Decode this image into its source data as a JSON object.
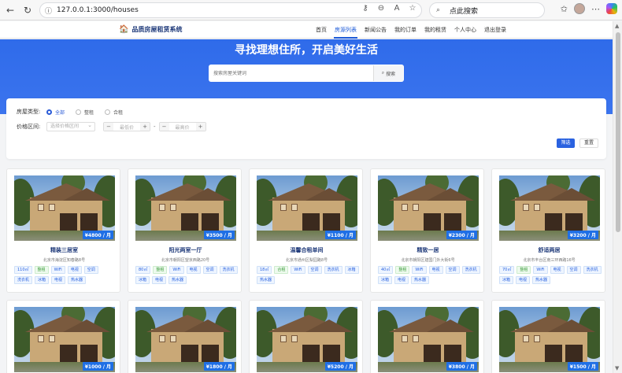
{
  "browser": {
    "url": "127.0.0.1:3000/houses",
    "search_placeholder": "点此搜索"
  },
  "app": {
    "title": "品质房屋租赁系统",
    "nav": [
      "首页",
      "房源列表",
      "新闻公告",
      "我的订单",
      "我的租赁",
      "个人中心",
      "退出登录"
    ],
    "active_nav": "房源列表"
  },
  "hero": {
    "title": "寻找理想住所，开启美好生活",
    "search_placeholder": "搜索房屋关键词",
    "search_button": "搜索"
  },
  "filter": {
    "type_label": "房屋类型:",
    "types": [
      "全部",
      "整租",
      "合租"
    ],
    "selected_type": "全部",
    "price_label": "价格区间:",
    "price_select_placeholder": "选择价格区间",
    "min_placeholder": "最低价",
    "max_placeholder": "最高价",
    "dash": "-",
    "filter_button": "筛选",
    "reset_button": "重置"
  },
  "houses": [
    {
      "name": "精装三居室",
      "address": "北京市海淀区知春路8号",
      "price": "¥4800 / 月",
      "tags": [
        "110㎡",
        "整租",
        "WiFi",
        "电视",
        "空调",
        "洗衣机",
        "冰箱",
        "电视",
        "热水器"
      ]
    },
    {
      "name": "阳光两室一厅",
      "address": "北京市朝阳区望京西路20号",
      "price": "¥3500 / 月",
      "tags": [
        "80㎡",
        "整租",
        "WiFi",
        "电视",
        "空调",
        "洗衣机",
        "冰箱",
        "电视",
        "热水器"
      ]
    },
    {
      "name": "温馨合租单间",
      "address": "北京市通州区梨园路8号",
      "price": "¥1100 / 月",
      "tags": [
        "18㎡",
        "合租",
        "WiFi",
        "空调",
        "洗衣机",
        "冰箱",
        "热水器"
      ]
    },
    {
      "name": "精致一居",
      "address": "北京市朝阳区建国门外大街6号",
      "price": "¥2300 / 月",
      "tags": [
        "40㎡",
        "整租",
        "WiFi",
        "电视",
        "空调",
        "洗衣机",
        "冰箱",
        "电视",
        "热水器"
      ]
    },
    {
      "name": "舒适两居",
      "address": "北京市丰台区南三环西路16号",
      "price": "¥3200 / 月",
      "tags": [
        "70㎡",
        "整租",
        "WiFi",
        "电视",
        "空调",
        "洗衣机",
        "冰箱",
        "电视",
        "热水器"
      ]
    },
    {
      "price": "¥1000 / 月"
    },
    {
      "price": "¥1800 / 月"
    },
    {
      "price": "¥5200 / 月"
    },
    {
      "price": "¥3800 / 月"
    },
    {
      "price": "¥1500 / 月"
    }
  ]
}
